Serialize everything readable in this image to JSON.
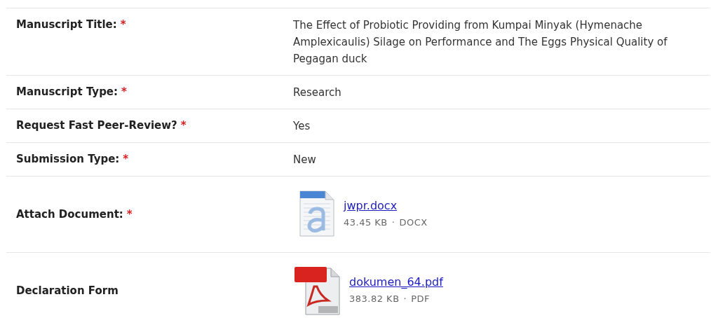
{
  "rows": [
    {
      "kind": "text",
      "label": "Manuscript Title:",
      "required_mark": "*",
      "value": "The Effect of Probiotic Providing from Kumpai Minyak (Hymenache Amplexicaulis) Silage on Performance and The Eggs Physical Quality of Pegagan duck"
    },
    {
      "kind": "text",
      "label": "Manuscript Type:",
      "required_mark": "*",
      "value": "Research"
    },
    {
      "kind": "text",
      "label": "Request Fast Peer-Review?",
      "required_mark": "*",
      "value": "Yes"
    },
    {
      "kind": "text",
      "label": "Submission Type:",
      "required_mark": "*",
      "value": "New"
    },
    {
      "kind": "file",
      "label": "Attach Document:",
      "required_mark": "*",
      "file": {
        "kind": "docx",
        "name": "jwpr.docx",
        "size": "43.45 KB",
        "separator": "·",
        "format": "DOCX"
      }
    },
    {
      "kind": "file",
      "label": "Declaration Form",
      "file": {
        "kind": "pdf",
        "name": "dokumen_64.pdf",
        "size": "383.82 KB",
        "separator": "·",
        "format": "PDF"
      }
    }
  ]
}
